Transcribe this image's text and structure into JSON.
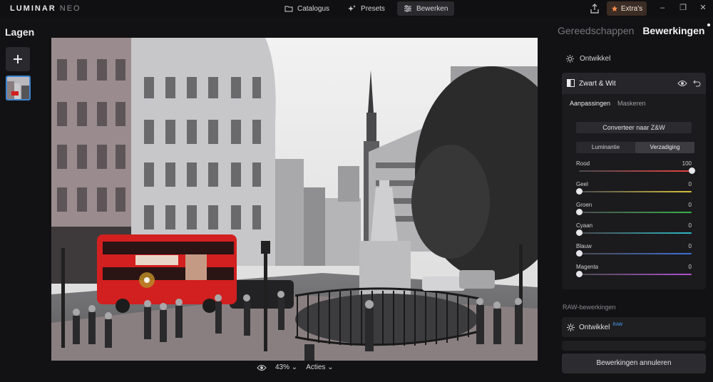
{
  "app": {
    "logo_main": "LUMINAR",
    "logo_sub": "NEO"
  },
  "top_nav": {
    "tabs": [
      {
        "label": "Catalogus",
        "icon": "folder-icon"
      },
      {
        "label": "Presets",
        "icon": "sparkle-icon"
      },
      {
        "label": "Bewerken",
        "icon": "sliders-icon",
        "active": true
      }
    ],
    "extras_label": "Extra's"
  },
  "left_panel": {
    "title": "Lagen"
  },
  "bottom_bar": {
    "zoom": "43%",
    "actions": "Acties"
  },
  "right_panel": {
    "tabs": {
      "tools": "Gereedschappen",
      "edits": "Bewerkingen"
    },
    "develop_label": "Ontwikkel",
    "tool": {
      "title": "Zwart & Wit",
      "subtabs": [
        "Aanpassingen",
        "Maskeren"
      ],
      "convert_button": "Converteer naar Z&W",
      "toggle": [
        "Luminantie",
        "Verzadiging"
      ],
      "sliders": [
        {
          "label": "Rood",
          "value": 100,
          "color": "#e8413d"
        },
        {
          "label": "Geel",
          "value": 0,
          "color": "#d9c13a"
        },
        {
          "label": "Groen",
          "value": 0,
          "color": "#39b24a"
        },
        {
          "label": "Cyaan",
          "value": 0,
          "color": "#2bb8c4"
        },
        {
          "label": "Blauw",
          "value": 0,
          "color": "#3d6fd8"
        },
        {
          "label": "Magenta",
          "value": 0,
          "color": "#b24ed3"
        }
      ]
    },
    "raw_section": "RAW-bewerkingen",
    "raw_items": [
      {
        "label": "Ontwikkel",
        "badge": "RAW"
      }
    ],
    "cancel_button": "Bewerkingen annuleren"
  },
  "colors": {
    "accent": "#3d86d4",
    "extras_bg": "#3b2c24",
    "bus_red": "#d21f1f"
  }
}
